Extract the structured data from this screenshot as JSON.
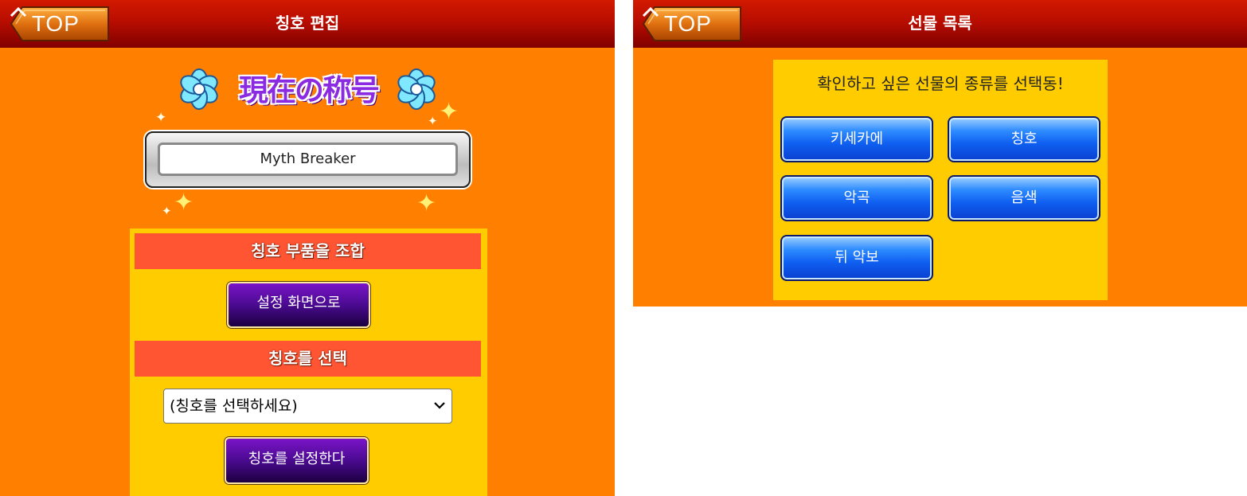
{
  "left_screen": {
    "header": {
      "back_button_label": "TOP",
      "title": "칭호 편집"
    },
    "emblem": {
      "text": "現在の称号"
    },
    "current_title": "Myth Breaker",
    "combine_section": {
      "heading": "칭호 부품을 조합",
      "button_label": "설정 화면으로"
    },
    "select_section": {
      "heading": "칭호를 선택",
      "dropdown_selected": "(칭호를 선택하세요)",
      "button_label": "칭호를 설정한다"
    }
  },
  "right_screen": {
    "header": {
      "back_button_label": "TOP",
      "title": "선물 목록"
    },
    "prompt": "확인하고 싶은 선물의 종류를 선택동!",
    "buttons": [
      "키세카에",
      "칭호",
      "악곡",
      "음색",
      "뒤 악보"
    ]
  },
  "colors": {
    "background": "#ff7f00",
    "header_red": "#b80d00",
    "content_yellow": "#ffcc00",
    "section_red": "#ff5533",
    "purple_button": "#4a0a90",
    "blue_button": "#0f5ff0"
  }
}
